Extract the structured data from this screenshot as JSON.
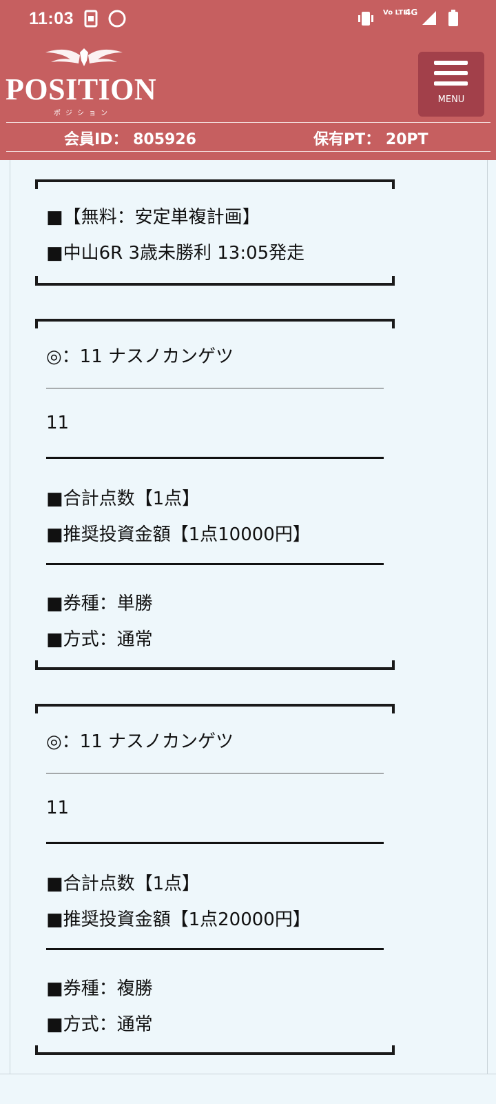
{
  "status_bar": {
    "time": "11:03",
    "icons": [
      "screen-share-icon",
      "moon-icon",
      "vibrate-icon",
      "volte-icon",
      "signal-4g-icon",
      "battery-icon"
    ],
    "volte_label": "Vo LTE",
    "network_label": "4G"
  },
  "header": {
    "logo_text": "POSITION",
    "logo_kana": "ポジション",
    "menu_label": "MENU",
    "member_id_label": "会員ID：",
    "member_id_value": "805926",
    "points_label": "保有PT：",
    "points_value": "20PT"
  },
  "blocks": [
    {
      "lines": [
        "■【無料：安定単複計画】",
        "■中山6R 3歳未勝利 13:05発走"
      ]
    },
    {
      "pick": "◎：11 ナスノカンゲツ",
      "number": "11",
      "total": "■合計点数【1点】",
      "amount": "■推奨投資金額【1点10000円】",
      "ticket_type": "■券種：単勝",
      "method": "■方式：通常"
    },
    {
      "pick": "◎：11 ナスノカンゲツ",
      "number": "11",
      "total": "■合計点数【1点】",
      "amount": "■推奨投資金額【1点20000円】",
      "ticket_type": "■券種：複勝",
      "method": "■方式：通常"
    }
  ],
  "colors": {
    "brand": "#c65f60",
    "menu_button": "#a2404a",
    "page_background": "#eef7fb"
  }
}
